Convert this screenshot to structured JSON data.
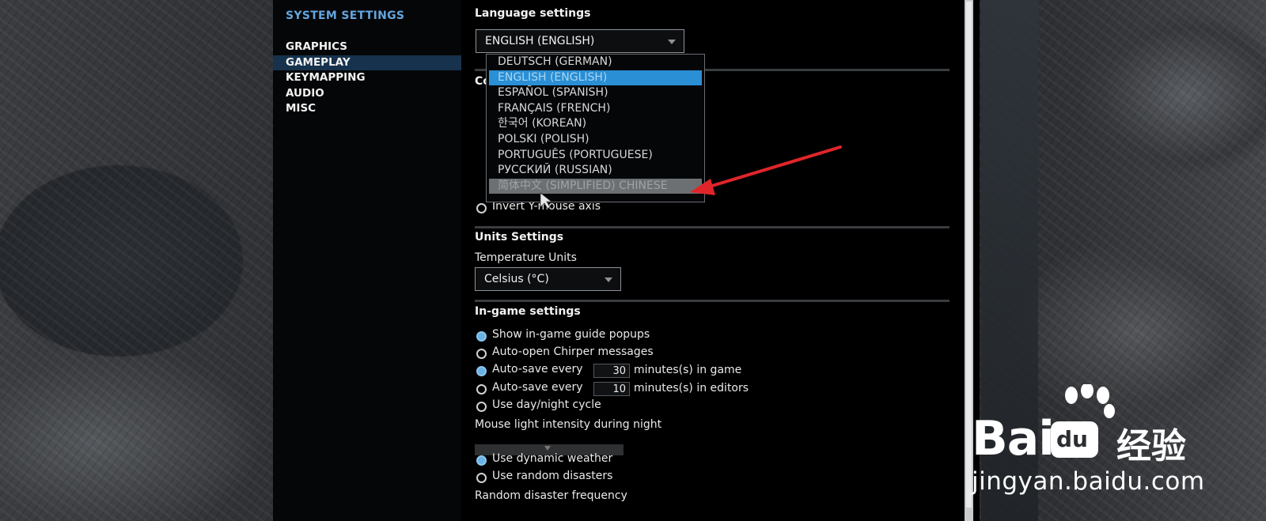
{
  "sidebar": {
    "title": "SYSTEM SETTINGS",
    "items": [
      {
        "label": "GRAPHICS",
        "active": false
      },
      {
        "label": "GAMEPLAY",
        "active": true
      },
      {
        "label": "KEYMAPPING",
        "active": false
      },
      {
        "label": "AUDIO",
        "active": false
      },
      {
        "label": "MISC",
        "active": false
      }
    ]
  },
  "language": {
    "heading": "Language settings",
    "selected": "ENGLISH (ENGLISH)",
    "options": [
      "DEUTSCH (GERMAN)",
      "ENGLISH (ENGLISH)",
      "ESPAÑOL (SPANISH)",
      "FRANÇAIS (FRENCH)",
      "한국어 (KOREAN)",
      "POLSKI (POLISH)",
      "PORTUGUÊS (PORTUGUESE)",
      "РУССКИЙ (RUSSIAN)",
      "简体中文 (SIMPLIFIED) CHINESE"
    ],
    "selected_index": 1,
    "hover_index": 8
  },
  "controls": {
    "partial_heading": "Co",
    "invert_label": "Invert Y-mouse axis",
    "invert_on": false
  },
  "units": {
    "heading": "Units Settings",
    "temp_label": "Temperature Units",
    "temp_value": "Celsius (°C)"
  },
  "ingame": {
    "heading": "In-game settings",
    "guide_popups": {
      "label": "Show in-game guide popups",
      "on": true
    },
    "chirper": {
      "label": "Auto-open Chirper messages",
      "on": false
    },
    "autosave_game": {
      "label": "Auto-save every",
      "value": "30",
      "suffix": "minutes(s) in game",
      "on": true
    },
    "autosave_editor": {
      "label": "Auto-save every",
      "value": "10",
      "suffix": "minutes(s) in editors",
      "on": false
    },
    "daynight": {
      "label": "Use day/night cycle",
      "on": false
    },
    "mouse_light_label": "Mouse light intensity during night",
    "dynamic_weather": {
      "label": "Use dynamic weather",
      "on": true
    },
    "random_disasters": {
      "label": "Use random disasters",
      "on": false
    },
    "disaster_freq_label": "Random disaster frequency"
  },
  "watermark": {
    "brand_left": "Bai",
    "brand_du": "du",
    "brand_cn": "经验",
    "url": "jingyan.baidu.com"
  },
  "colors": {
    "accent": "#63a6df",
    "selected": "#2a8fd4",
    "arrow": "#e0252a"
  }
}
